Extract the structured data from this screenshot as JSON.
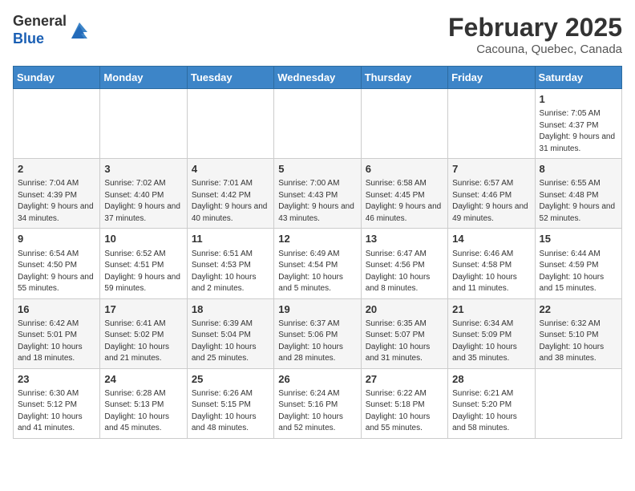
{
  "header": {
    "logo_general": "General",
    "logo_blue": "Blue",
    "month_year": "February 2025",
    "location": "Cacouna, Quebec, Canada"
  },
  "days_of_week": [
    "Sunday",
    "Monday",
    "Tuesday",
    "Wednesday",
    "Thursday",
    "Friday",
    "Saturday"
  ],
  "weeks": [
    [
      {
        "day": "",
        "info": ""
      },
      {
        "day": "",
        "info": ""
      },
      {
        "day": "",
        "info": ""
      },
      {
        "day": "",
        "info": ""
      },
      {
        "day": "",
        "info": ""
      },
      {
        "day": "",
        "info": ""
      },
      {
        "day": "1",
        "info": "Sunrise: 7:05 AM\nSunset: 4:37 PM\nDaylight: 9 hours and 31 minutes."
      }
    ],
    [
      {
        "day": "2",
        "info": "Sunrise: 7:04 AM\nSunset: 4:39 PM\nDaylight: 9 hours and 34 minutes."
      },
      {
        "day": "3",
        "info": "Sunrise: 7:02 AM\nSunset: 4:40 PM\nDaylight: 9 hours and 37 minutes."
      },
      {
        "day": "4",
        "info": "Sunrise: 7:01 AM\nSunset: 4:42 PM\nDaylight: 9 hours and 40 minutes."
      },
      {
        "day": "5",
        "info": "Sunrise: 7:00 AM\nSunset: 4:43 PM\nDaylight: 9 hours and 43 minutes."
      },
      {
        "day": "6",
        "info": "Sunrise: 6:58 AM\nSunset: 4:45 PM\nDaylight: 9 hours and 46 minutes."
      },
      {
        "day": "7",
        "info": "Sunrise: 6:57 AM\nSunset: 4:46 PM\nDaylight: 9 hours and 49 minutes."
      },
      {
        "day": "8",
        "info": "Sunrise: 6:55 AM\nSunset: 4:48 PM\nDaylight: 9 hours and 52 minutes."
      }
    ],
    [
      {
        "day": "9",
        "info": "Sunrise: 6:54 AM\nSunset: 4:50 PM\nDaylight: 9 hours and 55 minutes."
      },
      {
        "day": "10",
        "info": "Sunrise: 6:52 AM\nSunset: 4:51 PM\nDaylight: 9 hours and 59 minutes."
      },
      {
        "day": "11",
        "info": "Sunrise: 6:51 AM\nSunset: 4:53 PM\nDaylight: 10 hours and 2 minutes."
      },
      {
        "day": "12",
        "info": "Sunrise: 6:49 AM\nSunset: 4:54 PM\nDaylight: 10 hours and 5 minutes."
      },
      {
        "day": "13",
        "info": "Sunrise: 6:47 AM\nSunset: 4:56 PM\nDaylight: 10 hours and 8 minutes."
      },
      {
        "day": "14",
        "info": "Sunrise: 6:46 AM\nSunset: 4:58 PM\nDaylight: 10 hours and 11 minutes."
      },
      {
        "day": "15",
        "info": "Sunrise: 6:44 AM\nSunset: 4:59 PM\nDaylight: 10 hours and 15 minutes."
      }
    ],
    [
      {
        "day": "16",
        "info": "Sunrise: 6:42 AM\nSunset: 5:01 PM\nDaylight: 10 hours and 18 minutes."
      },
      {
        "day": "17",
        "info": "Sunrise: 6:41 AM\nSunset: 5:02 PM\nDaylight: 10 hours and 21 minutes."
      },
      {
        "day": "18",
        "info": "Sunrise: 6:39 AM\nSunset: 5:04 PM\nDaylight: 10 hours and 25 minutes."
      },
      {
        "day": "19",
        "info": "Sunrise: 6:37 AM\nSunset: 5:06 PM\nDaylight: 10 hours and 28 minutes."
      },
      {
        "day": "20",
        "info": "Sunrise: 6:35 AM\nSunset: 5:07 PM\nDaylight: 10 hours and 31 minutes."
      },
      {
        "day": "21",
        "info": "Sunrise: 6:34 AM\nSunset: 5:09 PM\nDaylight: 10 hours and 35 minutes."
      },
      {
        "day": "22",
        "info": "Sunrise: 6:32 AM\nSunset: 5:10 PM\nDaylight: 10 hours and 38 minutes."
      }
    ],
    [
      {
        "day": "23",
        "info": "Sunrise: 6:30 AM\nSunset: 5:12 PM\nDaylight: 10 hours and 41 minutes."
      },
      {
        "day": "24",
        "info": "Sunrise: 6:28 AM\nSunset: 5:13 PM\nDaylight: 10 hours and 45 minutes."
      },
      {
        "day": "25",
        "info": "Sunrise: 6:26 AM\nSunset: 5:15 PM\nDaylight: 10 hours and 48 minutes."
      },
      {
        "day": "26",
        "info": "Sunrise: 6:24 AM\nSunset: 5:16 PM\nDaylight: 10 hours and 52 minutes."
      },
      {
        "day": "27",
        "info": "Sunrise: 6:22 AM\nSunset: 5:18 PM\nDaylight: 10 hours and 55 minutes."
      },
      {
        "day": "28",
        "info": "Sunrise: 6:21 AM\nSunset: 5:20 PM\nDaylight: 10 hours and 58 minutes."
      },
      {
        "day": "",
        "info": ""
      }
    ]
  ]
}
